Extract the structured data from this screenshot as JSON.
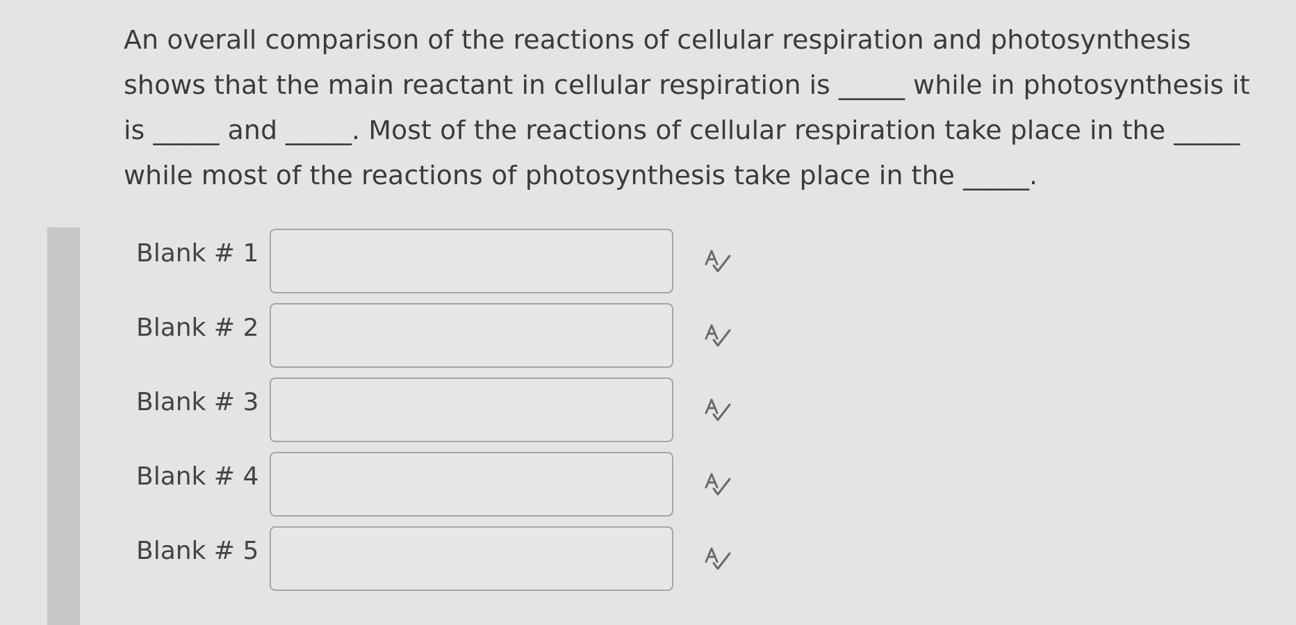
{
  "question": {
    "text": "An overall comparison of the reactions of cellular respiration and photosynthesis shows that the main reactant in cellular respiration is _____ while in photosynthesis it is _____ and _____. Most of the reactions of cellular respiration take place in the _____ while most of the reactions of photosynthesis take place in the _____."
  },
  "blanks": [
    {
      "label": "Blank # 1"
    },
    {
      "label": "Blank # 2"
    },
    {
      "label": "Blank # 3"
    },
    {
      "label": "Blank # 4"
    },
    {
      "label": "Blank # 5"
    }
  ]
}
